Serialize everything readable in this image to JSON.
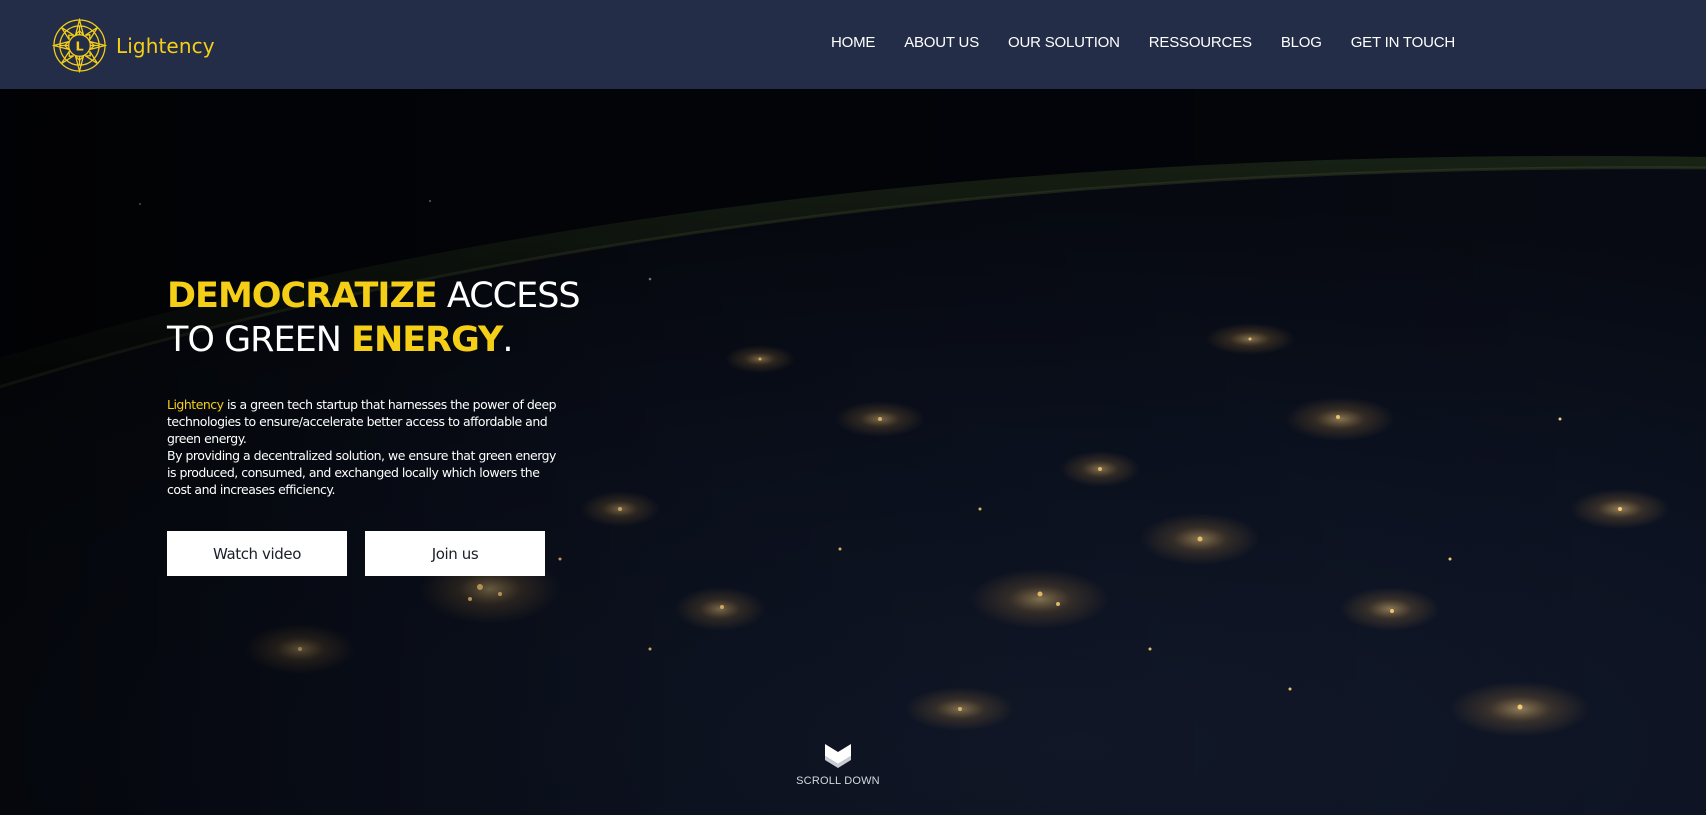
{
  "header": {
    "brand_name": "Lightency",
    "logo_letter": "L",
    "nav": [
      "HOME",
      "ABOUT US",
      "OUR SOLUTION",
      "RESSOURCES",
      "BLOG",
      "GET IN TOUCH"
    ]
  },
  "hero": {
    "headline": {
      "part1": "DEMOCRATIZE",
      "part2": " ACCESS",
      "part3": "TO GREEN ",
      "part4": "ENERGY",
      "part5": "."
    },
    "description": {
      "brand": "Lightency",
      "line1_rest": " is a green tech startup that harnesses the power of deep technologies to ensure/accelerate better access to affordable and green energy.",
      "line2": "By providing a decentralized solution, we ensure that green energy is produced, consumed, and exchanged locally which lowers the cost and increases efficiency."
    },
    "buttons": {
      "watch_video": "Watch video",
      "join_us": "Join us"
    },
    "scroll_label": "SCROLL DOWN"
  },
  "colors": {
    "accent": "#f5cf17",
    "navbar": "#232d48",
    "background": "#05070d"
  },
  "icons": {
    "logo": "sun-logo-icon",
    "scroll": "chevron-down-icon"
  }
}
